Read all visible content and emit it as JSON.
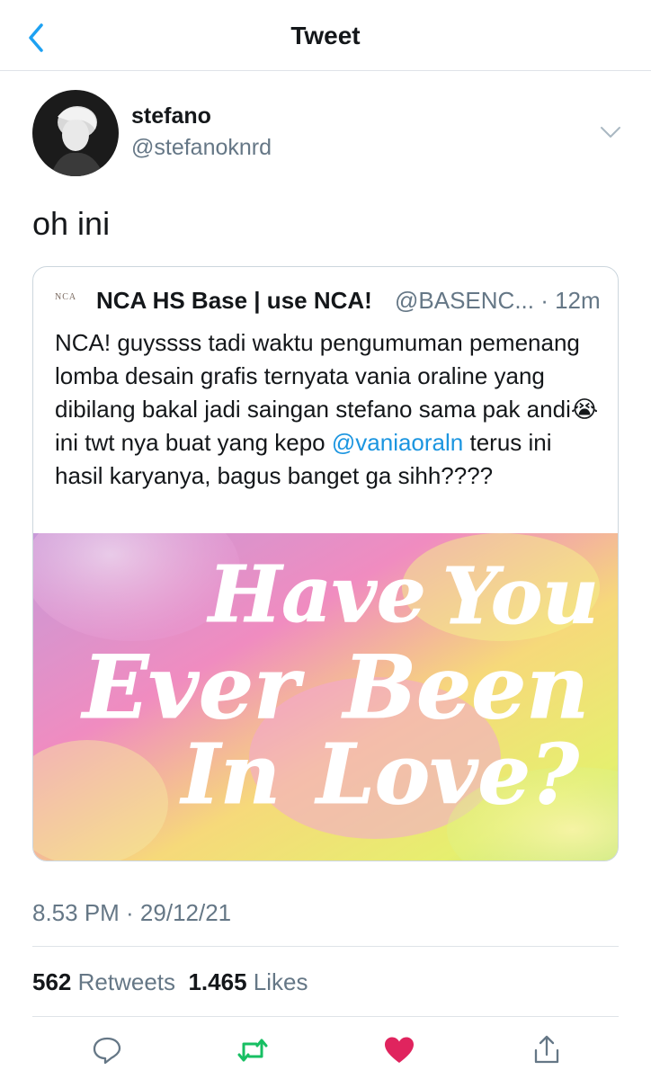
{
  "nav": {
    "title": "Tweet",
    "back_icon": "chevron-left-icon"
  },
  "author": {
    "name": "stefano",
    "handle": "@stefanoknrd",
    "avatar_icon": "avatar"
  },
  "tweet": {
    "text": "oh ini"
  },
  "quoted": {
    "logo_text": "NCA",
    "name": "NCA HS Base | use NCA!",
    "handle": "@BASENC...",
    "time": "· 12m",
    "text_part1": "NCA! guyssss tadi waktu pengumuman pemenang lomba desain grafis ternyata vania oraline yang dibilang bakal jadi saingan stefano sama pak andi",
    "emoji": "😭",
    "text_part2": " ini twt nya buat yang kepo ",
    "mention": "@vaniaoraln",
    "text_part3": " terus ini hasil karyanya, bagus banget ga sihh????",
    "image_text": [
      "Have",
      "You",
      "Ever",
      "Been",
      "In",
      "Love?"
    ]
  },
  "meta": {
    "timestamp": "8.53 PM · 29/12/21"
  },
  "stats": {
    "retweets_count": "562",
    "retweets_label": "Retweets",
    "likes_count": "1.465",
    "likes_label": "Likes"
  },
  "actions": [
    "reply-icon",
    "retweet-icon",
    "like-icon",
    "share-icon"
  ],
  "colors": {
    "link": "#1b95e0",
    "retweet": "#17bf63",
    "like": "#e0245e",
    "secondary": "#657786"
  }
}
